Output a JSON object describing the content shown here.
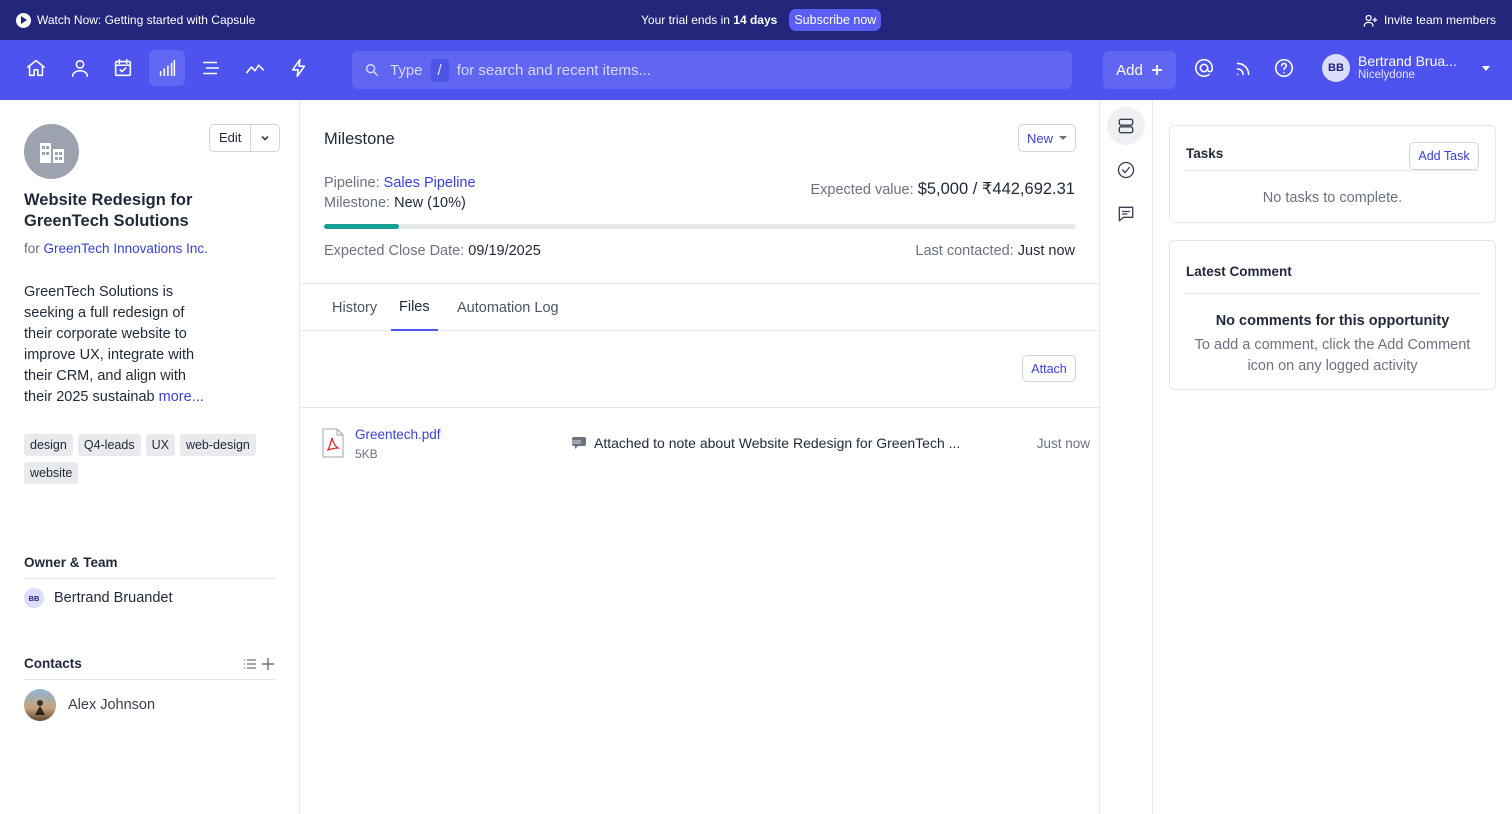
{
  "topbar": {
    "watch": "Watch Now: Getting started with Capsule",
    "trial_prefix": "Your trial ends in",
    "trial_days": "14 days",
    "subscribe": "Subscribe now",
    "invite": "Invite team members"
  },
  "nav": {
    "search_type": "Type",
    "search_slash": "/",
    "search_rest": "for search and recent items...",
    "add": "Add",
    "user_initials": "BB",
    "user_name": "Bertrand Brua...",
    "user_org": "Nicelydone",
    "icons": [
      "home-icon",
      "person-icon",
      "calendar-icon",
      "bar-chart-icon",
      "list-icon",
      "trend-icon",
      "lightning-icon"
    ],
    "active_icon": "bar-chart-icon"
  },
  "opportunity": {
    "edit": "Edit",
    "name": "Website Redesign for GreenTech Solutions",
    "for_prefix": "for",
    "for_org": "GreenTech Innovations Inc.",
    "description": "GreenTech Solutions is seeking a full redesign of their corporate website to improve UX, integrate with their CRM, and align with their 2025 sustainab",
    "more": "more...",
    "tags": [
      "design",
      "Q4-leads",
      "UX",
      "web-design",
      "website"
    ],
    "owner_heading": "Owner & Team",
    "owner_initials": "BB",
    "owner_name": "Bertrand Bruandet",
    "contacts_heading": "Contacts",
    "contact_name": "Alex Johnson"
  },
  "milestone": {
    "title": "Milestone",
    "status": "New",
    "pipeline_label": "Pipeline:",
    "pipeline_value": "Sales Pipeline",
    "milestone_label": "Milestone:",
    "milestone_value": "New (10%)",
    "progress": 0.1,
    "expected_label": "Expected value:",
    "expected_value": "$5,000 / ₹442,692.31",
    "close_label": "Expected Close Date:",
    "close_value": "09/19/2025",
    "contacted_label": "Last contacted:",
    "contacted_value": "Just now"
  },
  "tabs": [
    "History",
    "Files",
    "Automation Log"
  ],
  "active_tab": "Files",
  "files": {
    "attach": "Attach",
    "items": [
      {
        "name": "Greentech.pdf",
        "size": "5KB",
        "note": "Attached to note about Website Redesign for GreenTech ...",
        "time": "Just now"
      }
    ]
  },
  "tasks": {
    "title": "Tasks",
    "add": "Add Task",
    "empty": "No tasks to complete."
  },
  "comments": {
    "title": "Latest Comment",
    "empty_title": "No comments for this opportunity",
    "empty_body": "To add a comment, click the Add Comment icon on any logged activity"
  },
  "colors": {
    "topbar": "#23267a",
    "navbar": "#4d53ee",
    "link": "#3b3fd6",
    "progress": "#169f93"
  }
}
